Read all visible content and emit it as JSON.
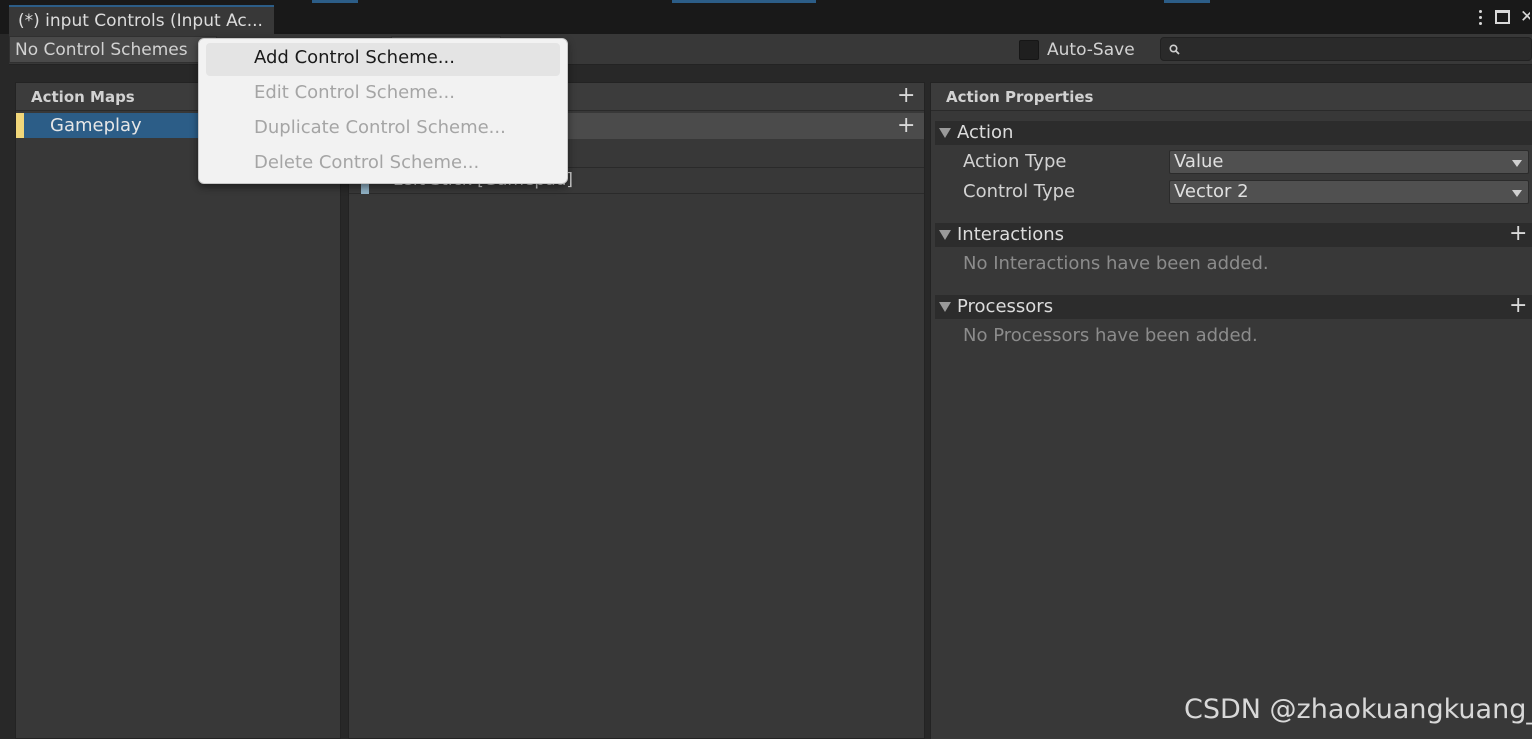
{
  "window": {
    "tab_title": "(*) input Controls (Input Ac..."
  },
  "toolbar": {
    "control_scheme": "No Control Schemes",
    "auto_save_label": "Auto-Save",
    "auto_save_checked": false,
    "search_placeholder": ""
  },
  "action_maps": {
    "header": "Action Maps",
    "items": [
      {
        "label": "Gameplay",
        "selected": true
      }
    ]
  },
  "actions": {
    "bindings": [
      {
        "label": "Left Stick [Gamepad]"
      }
    ]
  },
  "action_properties": {
    "header": "Action Properties",
    "action_section": "Action",
    "action_type_label": "Action Type",
    "action_type_value": "Value",
    "control_type_label": "Control Type",
    "control_type_value": "Vector 2",
    "interactions_section": "Interactions",
    "interactions_empty": "No Interactions have been added.",
    "processors_section": "Processors",
    "processors_empty": "No Processors have been added."
  },
  "context_menu": {
    "items": [
      {
        "label": "Add Control Scheme...",
        "enabled": true
      },
      {
        "label": "Edit Control Scheme...",
        "enabled": false
      },
      {
        "label": "Duplicate Control Scheme...",
        "enabled": false
      },
      {
        "label": "Delete Control Scheme...",
        "enabled": false
      }
    ]
  },
  "watermark": "CSDN @zhaokuangkuang_",
  "colors": {
    "selection": "#2c5d87",
    "map_accent": "#f0d67a",
    "binding_accent": "#8fb0c4",
    "panel_bg": "#383838"
  }
}
